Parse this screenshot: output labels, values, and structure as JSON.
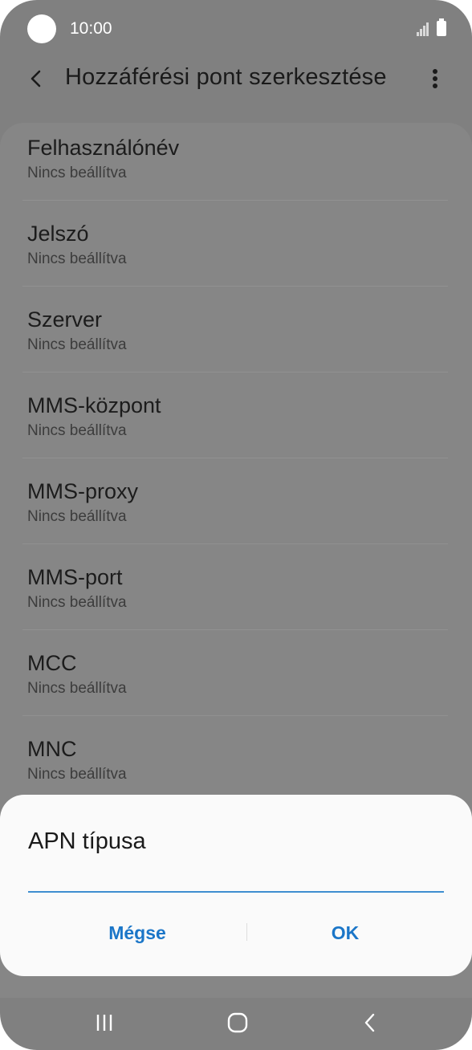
{
  "status_bar": {
    "time": "10:00",
    "icons": [
      "camera-cutout",
      "signal-icon",
      "battery-icon"
    ]
  },
  "app_bar": {
    "title": "Hozzáférési pont szerkesztése",
    "icons": [
      "back-arrow-icon",
      "more-vertical-icon"
    ]
  },
  "list": [
    {
      "title": "Felhasználónév",
      "value": "Nincs beállítva"
    },
    {
      "title": "Jelszó",
      "value": "Nincs beállítva"
    },
    {
      "title": "Szerver",
      "value": "Nincs beállítva"
    },
    {
      "title": "MMS-központ",
      "value": "Nincs beállítva"
    },
    {
      "title": "MMS-proxy",
      "value": "Nincs beállítva"
    },
    {
      "title": "MMS-port",
      "value": "Nincs beállítva"
    },
    {
      "title": "MCC",
      "value": "Nincs beállítva"
    },
    {
      "title": "MNC",
      "value": "Nincs beállítva"
    }
  ],
  "dialog": {
    "title": "APN típusa",
    "input_value": "",
    "cancel_label": "Mégse",
    "ok_label": "OK"
  },
  "nav_bar": {
    "icons": [
      "recent-apps-icon",
      "home-icon",
      "back-icon"
    ]
  },
  "colors": {
    "accent": "#1b76c8",
    "input_underline": "#3e8ed0",
    "scrim": "#808080",
    "dialog_bg": "#fafafa"
  }
}
